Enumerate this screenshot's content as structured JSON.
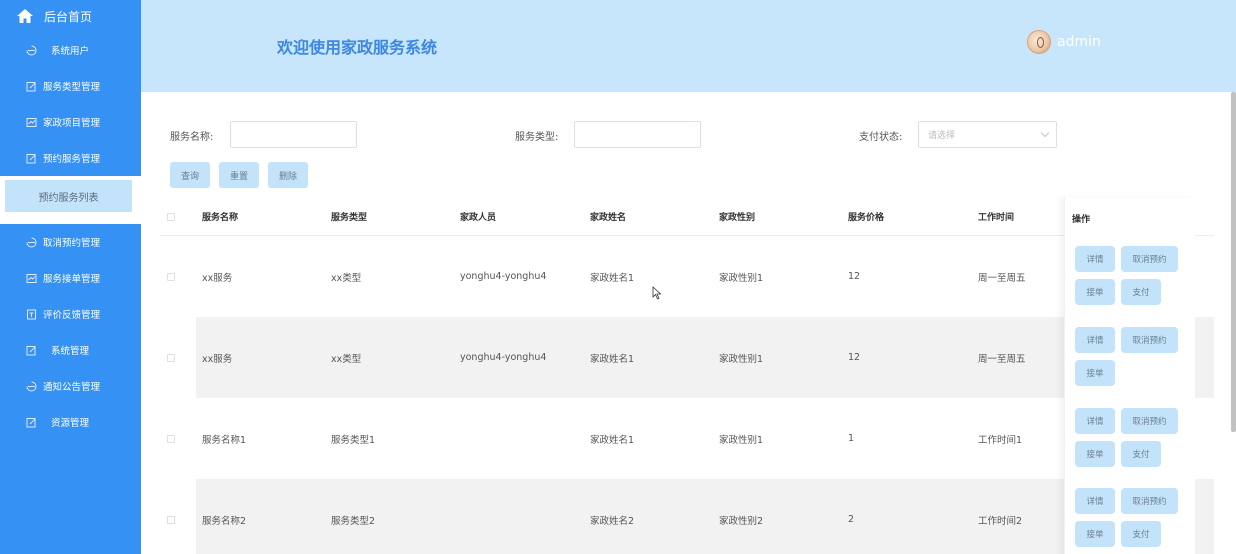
{
  "sidebar": {
    "home": "后台首页",
    "items": [
      {
        "label": "系统用户",
        "icon": "user-icon"
      },
      {
        "label": "服务类型管理",
        "icon": "edit-icon"
      },
      {
        "label": "家政项目管理",
        "icon": "chart-icon"
      },
      {
        "label": "预约服务管理",
        "icon": "edit-icon"
      }
    ],
    "active_sub": "预约服务列表",
    "items2": [
      {
        "label": "取消预约管理",
        "icon": "user-icon"
      },
      {
        "label": "服务接单管理",
        "icon": "chart-icon"
      },
      {
        "label": "评价反馈管理",
        "icon": "doc-icon"
      },
      {
        "label": "系统管理",
        "icon": "edit-icon"
      },
      {
        "label": "通知公告管理",
        "icon": "user-icon"
      },
      {
        "label": "资源管理",
        "icon": "edit-icon"
      }
    ]
  },
  "header": {
    "title": "欢迎使用家政服务系统",
    "username": "admin"
  },
  "filters": {
    "service_name_label": "服务名称:",
    "service_type_label": "服务类型:",
    "pay_status_label": "支付状态:",
    "pay_status_placeholder": "请选择"
  },
  "buttons": {
    "query": "查询",
    "reset": "重置",
    "delete": "删除"
  },
  "table": {
    "columns": [
      "服务名称",
      "服务类型",
      "家政人员",
      "家政姓名",
      "家政性别",
      "服务价格",
      "工作时间",
      "操作"
    ],
    "rows": [
      {
        "cells": [
          "xx服务",
          "xx类型",
          "yonghu4-yonghu4",
          "家政姓名1",
          "家政性别1",
          "12",
          "周一至周五"
        ],
        "ops": [
          "详情",
          "取消预约",
          "接单",
          "支付"
        ]
      },
      {
        "cells": [
          "xx服务",
          "xx类型",
          "yonghu4-yonghu4",
          "家政姓名1",
          "家政性别1",
          "12",
          "周一至周五"
        ],
        "ops": [
          "详情",
          "取消预约",
          "接单"
        ]
      },
      {
        "cells": [
          "服务名称1",
          "服务类型1",
          "",
          "家政姓名1",
          "家政性别1",
          "1",
          "工作时间1"
        ],
        "ops": [
          "详情",
          "取消预约",
          "接单",
          "支付"
        ]
      },
      {
        "cells": [
          "服务名称2",
          "服务类型2",
          "",
          "家政姓名2",
          "家政性别2",
          "2",
          "工作时间2"
        ],
        "ops": [
          "详情",
          "取消预约",
          "接单",
          "支付"
        ]
      }
    ]
  },
  "colors": {
    "sidebar_bg": "#3592f4",
    "header_bg": "#c7e5fb",
    "title_color": "#3d88e0",
    "button_bg": "#c3e3fa"
  }
}
